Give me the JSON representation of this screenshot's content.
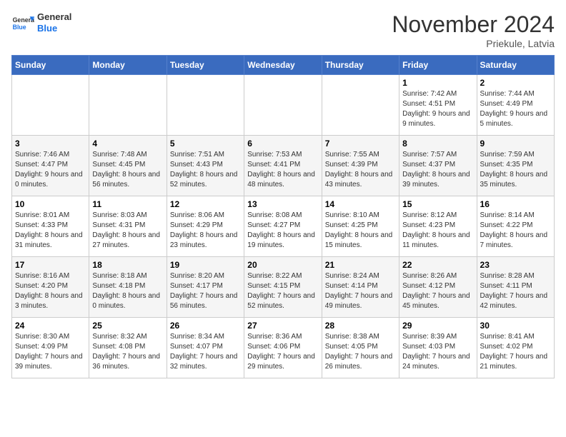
{
  "header": {
    "logo_general": "General",
    "logo_blue": "Blue",
    "month_title": "November 2024",
    "subtitle": "Priekule, Latvia"
  },
  "weekdays": [
    "Sunday",
    "Monday",
    "Tuesday",
    "Wednesday",
    "Thursday",
    "Friday",
    "Saturday"
  ],
  "weeks": [
    [
      {
        "day": "",
        "info": ""
      },
      {
        "day": "",
        "info": ""
      },
      {
        "day": "",
        "info": ""
      },
      {
        "day": "",
        "info": ""
      },
      {
        "day": "",
        "info": ""
      },
      {
        "day": "1",
        "info": "Sunrise: 7:42 AM\nSunset: 4:51 PM\nDaylight: 9 hours and 9 minutes."
      },
      {
        "day": "2",
        "info": "Sunrise: 7:44 AM\nSunset: 4:49 PM\nDaylight: 9 hours and 5 minutes."
      }
    ],
    [
      {
        "day": "3",
        "info": "Sunrise: 7:46 AM\nSunset: 4:47 PM\nDaylight: 9 hours and 0 minutes."
      },
      {
        "day": "4",
        "info": "Sunrise: 7:48 AM\nSunset: 4:45 PM\nDaylight: 8 hours and 56 minutes."
      },
      {
        "day": "5",
        "info": "Sunrise: 7:51 AM\nSunset: 4:43 PM\nDaylight: 8 hours and 52 minutes."
      },
      {
        "day": "6",
        "info": "Sunrise: 7:53 AM\nSunset: 4:41 PM\nDaylight: 8 hours and 48 minutes."
      },
      {
        "day": "7",
        "info": "Sunrise: 7:55 AM\nSunset: 4:39 PM\nDaylight: 8 hours and 43 minutes."
      },
      {
        "day": "8",
        "info": "Sunrise: 7:57 AM\nSunset: 4:37 PM\nDaylight: 8 hours and 39 minutes."
      },
      {
        "day": "9",
        "info": "Sunrise: 7:59 AM\nSunset: 4:35 PM\nDaylight: 8 hours and 35 minutes."
      }
    ],
    [
      {
        "day": "10",
        "info": "Sunrise: 8:01 AM\nSunset: 4:33 PM\nDaylight: 8 hours and 31 minutes."
      },
      {
        "day": "11",
        "info": "Sunrise: 8:03 AM\nSunset: 4:31 PM\nDaylight: 8 hours and 27 minutes."
      },
      {
        "day": "12",
        "info": "Sunrise: 8:06 AM\nSunset: 4:29 PM\nDaylight: 8 hours and 23 minutes."
      },
      {
        "day": "13",
        "info": "Sunrise: 8:08 AM\nSunset: 4:27 PM\nDaylight: 8 hours and 19 minutes."
      },
      {
        "day": "14",
        "info": "Sunrise: 8:10 AM\nSunset: 4:25 PM\nDaylight: 8 hours and 15 minutes."
      },
      {
        "day": "15",
        "info": "Sunrise: 8:12 AM\nSunset: 4:23 PM\nDaylight: 8 hours and 11 minutes."
      },
      {
        "day": "16",
        "info": "Sunrise: 8:14 AM\nSunset: 4:22 PM\nDaylight: 8 hours and 7 minutes."
      }
    ],
    [
      {
        "day": "17",
        "info": "Sunrise: 8:16 AM\nSunset: 4:20 PM\nDaylight: 8 hours and 3 minutes."
      },
      {
        "day": "18",
        "info": "Sunrise: 8:18 AM\nSunset: 4:18 PM\nDaylight: 8 hours and 0 minutes."
      },
      {
        "day": "19",
        "info": "Sunrise: 8:20 AM\nSunset: 4:17 PM\nDaylight: 7 hours and 56 minutes."
      },
      {
        "day": "20",
        "info": "Sunrise: 8:22 AM\nSunset: 4:15 PM\nDaylight: 7 hours and 52 minutes."
      },
      {
        "day": "21",
        "info": "Sunrise: 8:24 AM\nSunset: 4:14 PM\nDaylight: 7 hours and 49 minutes."
      },
      {
        "day": "22",
        "info": "Sunrise: 8:26 AM\nSunset: 4:12 PM\nDaylight: 7 hours and 45 minutes."
      },
      {
        "day": "23",
        "info": "Sunrise: 8:28 AM\nSunset: 4:11 PM\nDaylight: 7 hours and 42 minutes."
      }
    ],
    [
      {
        "day": "24",
        "info": "Sunrise: 8:30 AM\nSunset: 4:09 PM\nDaylight: 7 hours and 39 minutes."
      },
      {
        "day": "25",
        "info": "Sunrise: 8:32 AM\nSunset: 4:08 PM\nDaylight: 7 hours and 36 minutes."
      },
      {
        "day": "26",
        "info": "Sunrise: 8:34 AM\nSunset: 4:07 PM\nDaylight: 7 hours and 32 minutes."
      },
      {
        "day": "27",
        "info": "Sunrise: 8:36 AM\nSunset: 4:06 PM\nDaylight: 7 hours and 29 minutes."
      },
      {
        "day": "28",
        "info": "Sunrise: 8:38 AM\nSunset: 4:05 PM\nDaylight: 7 hours and 26 minutes."
      },
      {
        "day": "29",
        "info": "Sunrise: 8:39 AM\nSunset: 4:03 PM\nDaylight: 7 hours and 24 minutes."
      },
      {
        "day": "30",
        "info": "Sunrise: 8:41 AM\nSunset: 4:02 PM\nDaylight: 7 hours and 21 minutes."
      }
    ]
  ]
}
